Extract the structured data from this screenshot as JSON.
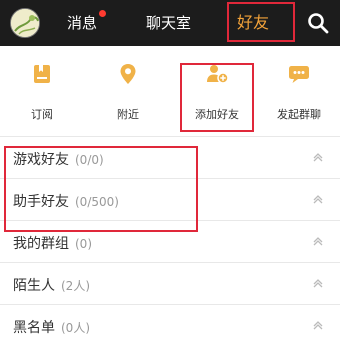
{
  "header": {
    "tabs": [
      {
        "label": "消息"
      },
      {
        "label": "聊天室"
      },
      {
        "label": "好友"
      }
    ]
  },
  "quick_actions": [
    {
      "label": "订阅",
      "icon": "bookmark-icon"
    },
    {
      "label": "附近",
      "icon": "location-pin-icon"
    },
    {
      "label": "添加好友",
      "icon": "add-friend-icon"
    },
    {
      "label": "发起群聊",
      "icon": "group-chat-icon"
    }
  ],
  "groups": [
    {
      "label": "游戏好友",
      "count": "(0/0)"
    },
    {
      "label": "助手好友",
      "count": "(0/500)"
    },
    {
      "label": "我的群组",
      "count": "(0)"
    },
    {
      "label": "陌生人",
      "count": "(2人)"
    },
    {
      "label": "黑名单",
      "count": "(0人)"
    }
  ],
  "colors": {
    "topbar": "#1c1c1c",
    "accent": "#f3a33a",
    "badge": "#ff3b30",
    "highlight": "#e0283a"
  }
}
